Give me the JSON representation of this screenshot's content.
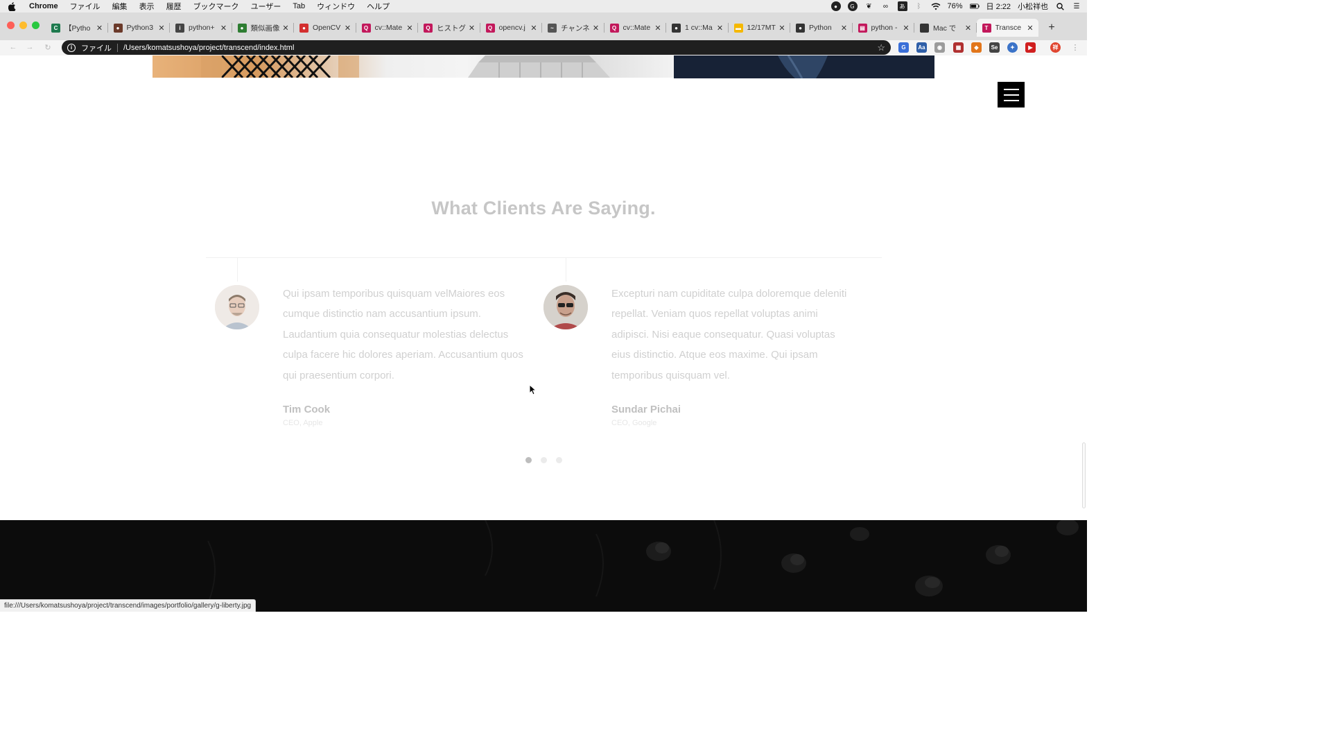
{
  "menubar": {
    "app_name": "Chrome",
    "items": [
      "ファイル",
      "編集",
      "表示",
      "履歴",
      "ブックマーク",
      "ユーザー",
      "Tab",
      "ウィンドウ",
      "ヘルプ"
    ],
    "battery": "76%",
    "clock": "日 2:22",
    "user": "小松祥也"
  },
  "tabs": [
    {
      "label": "【Pytho",
      "color": "#1e7a4e",
      "glyph": "C"
    },
    {
      "label": "Python3",
      "color": "#6b3a2a",
      "glyph": "●"
    },
    {
      "label": "python+",
      "color": "#444444",
      "glyph": "i"
    },
    {
      "label": "類似画像",
      "color": "#2e7d32",
      "glyph": "●"
    },
    {
      "label": "OpenCV",
      "color": "#d32f2f",
      "glyph": "●"
    },
    {
      "label": "cv::Mate",
      "color": "#c2185b",
      "glyph": "Q"
    },
    {
      "label": "ヒストグ",
      "color": "#c2185b",
      "glyph": "Q"
    },
    {
      "label": "opencv.j",
      "color": "#c2185b",
      "glyph": "Q"
    },
    {
      "label": "チャンネ",
      "color": "#555555",
      "glyph": "~"
    },
    {
      "label": "cv::Mate",
      "color": "#c2185b",
      "glyph": "Q"
    },
    {
      "label": "1 cv::Ma",
      "color": "#333333",
      "glyph": "●"
    },
    {
      "label": "12/17MT",
      "color": "#f5b800",
      "glyph": "▬"
    },
    {
      "label": "Python",
      "color": "#333333",
      "glyph": "●"
    },
    {
      "label": "python -",
      "color": "#c2185b",
      "glyph": "▤"
    },
    {
      "label": "Mac で",
      "color": "#333333",
      "glyph": ""
    },
    {
      "label": "Transce",
      "color": "#c2185b",
      "glyph": "T",
      "active": true
    }
  ],
  "addressbar": {
    "scheme_label": "ファイル",
    "url": "/Users/komatsushoya/project/transcend/index.html"
  },
  "section": {
    "title": "What Clients Are Saying."
  },
  "testimonials": [
    {
      "quote": "Qui ipsam temporibus quisquam velMaiores eos cumque distinctio nam accusantium ipsum. Laudantium quia consequatur molestias delectus culpa facere hic dolores aperiam. Accusantium quos qui praesentium corpori.",
      "name": "Tim Cook",
      "role": "CEO, Apple"
    },
    {
      "quote": "Excepturi nam cupiditate culpa doloremque deleniti repellat. Veniam quos repellat voluptas animi adipisci. Nisi eaque consequatur. Quasi voluptas eius distinctio. Atque eos maxime. Qui ipsam temporibus quisquam vel.",
      "name": "Sundar Pichai",
      "role": "CEO, Google"
    }
  ],
  "carousel": {
    "pages": 3,
    "active_index": 0
  },
  "statusbar": {
    "link": "file:///Users/komatsushoya/project/transcend/images/portfolio/gallery/g-liberty.jpg"
  },
  "colors": {
    "close": "#fe5f57",
    "minimize": "#febc2e",
    "zoom": "#28c840",
    "title_text": "#c6c6c6",
    "dark_section": "#0c0c0c"
  }
}
